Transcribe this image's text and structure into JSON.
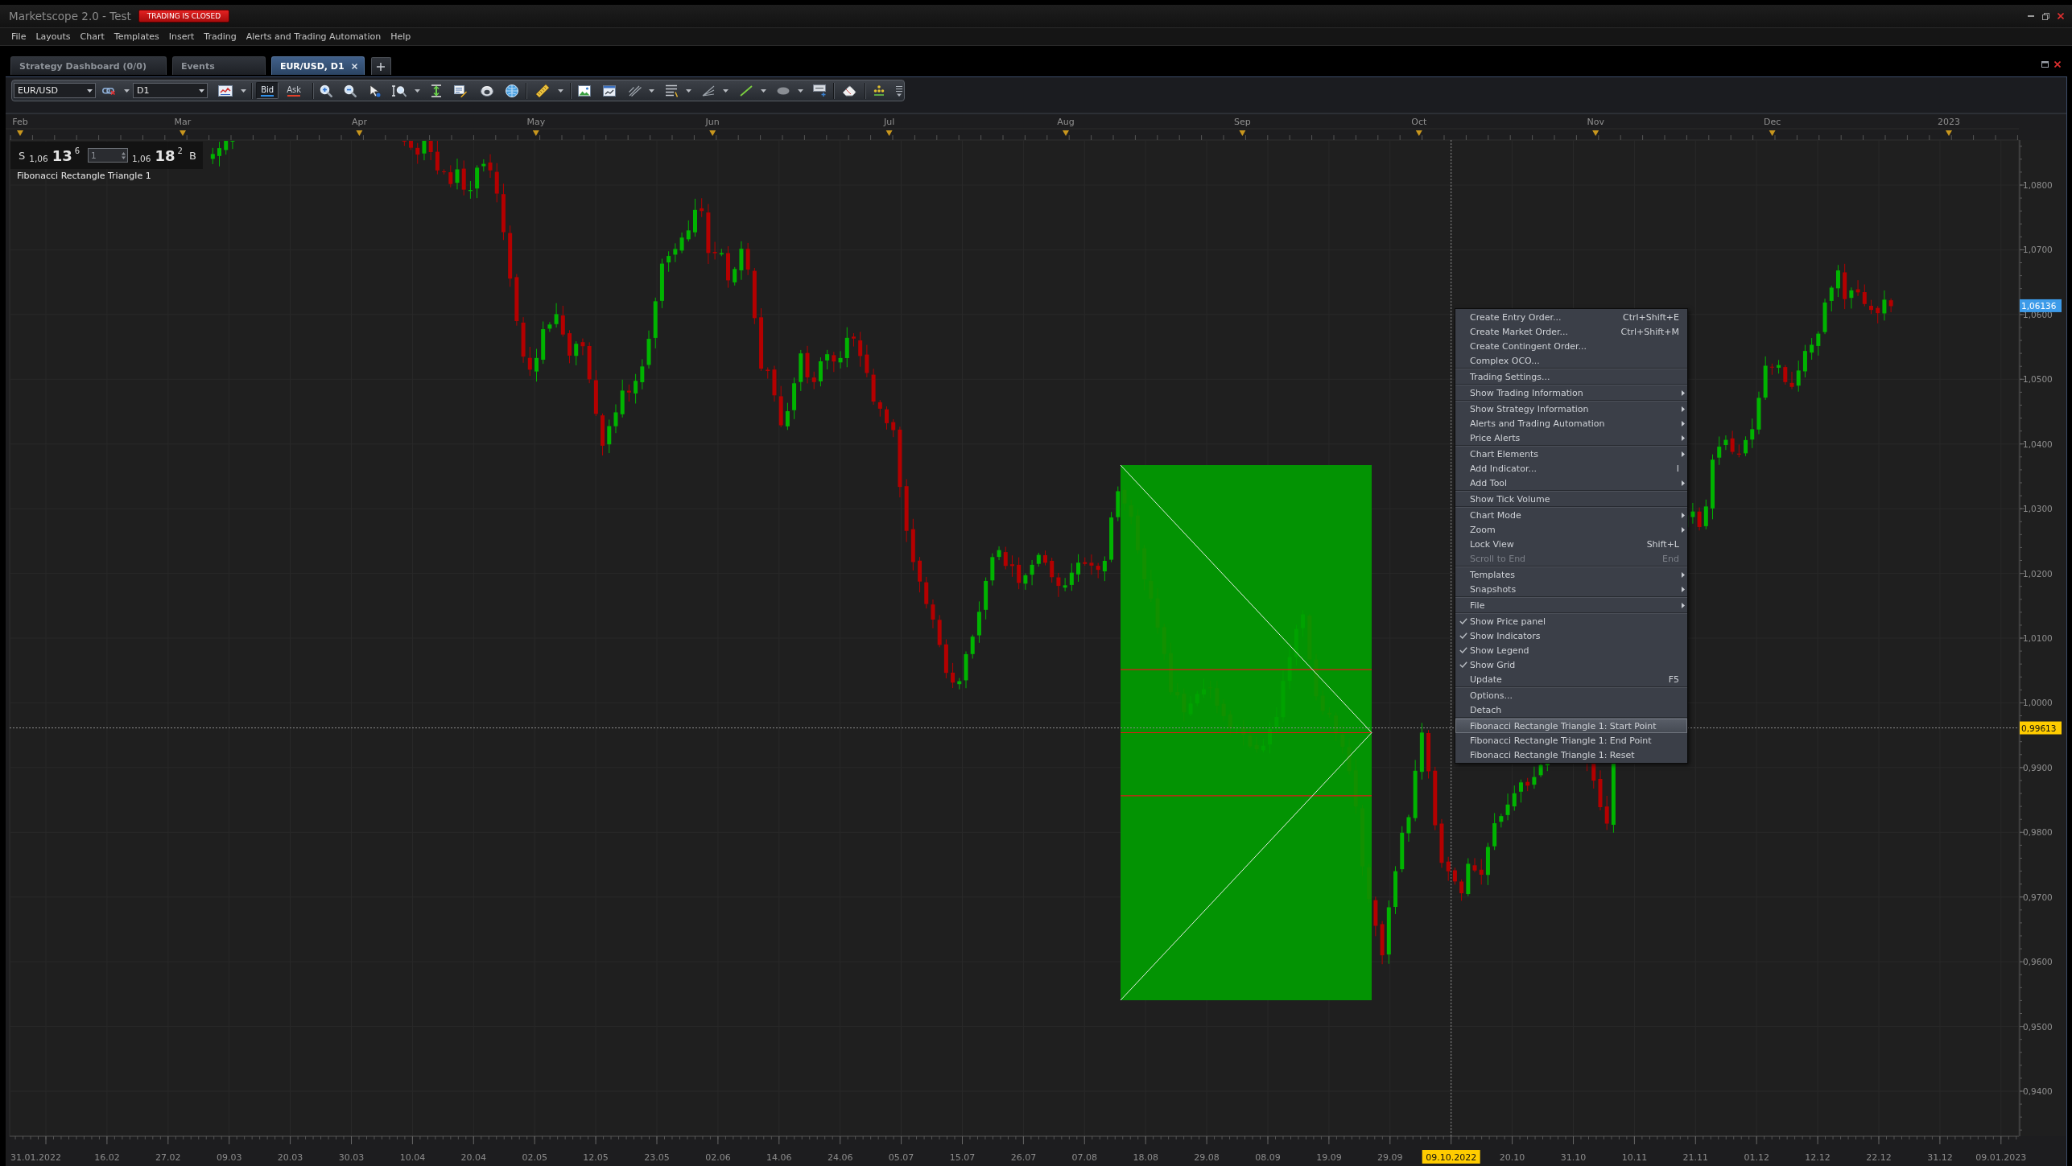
{
  "window": {
    "title": "Marketscope 2.0 - Test",
    "status_badge": "TRADING IS CLOSED"
  },
  "menu_bar": [
    "File",
    "Layouts",
    "Chart",
    "Templates",
    "Insert",
    "Trading",
    "Alerts and Trading Automation",
    "Help"
  ],
  "tabs": [
    {
      "label": "Strategy Dashboard (0/0)",
      "selected": false
    },
    {
      "label": "Events",
      "selected": false
    },
    {
      "label": "EUR/USD, D1",
      "selected": true
    }
  ],
  "toolbar": {
    "symbol": "EUR/USD",
    "timeframe": "D1",
    "quote_sides": [
      {
        "label": "Bid",
        "selected": true,
        "color": "#2f8fe8"
      },
      {
        "label": "Ask",
        "selected": false,
        "color": "#e0402a"
      }
    ]
  },
  "chart": {
    "price_panel": {
      "sell_label": "S",
      "sell_big_figure": "1,06",
      "sell_pips": "13",
      "sell_fraction": "6",
      "amount": "1",
      "buy_big_figure": "1,06",
      "buy_pips": "18",
      "buy_fraction": "2",
      "buy_label": "B"
    },
    "drawings": [
      {
        "kind": "fibonacci_rectangle_triangle",
        "legend": "Fibonacci Rectangle Triangle 1"
      }
    ],
    "month_axis": [
      "Feb",
      "Mar",
      "Apr",
      "May",
      "Jun",
      "Jul",
      "Aug",
      "Sep",
      "Oct",
      "Nov",
      "Dec",
      "2023"
    ],
    "price_axis": {
      "labels": [
        "1,0800",
        "1,0700",
        "1,0600",
        "1,0500",
        "1,0400",
        "1,0300",
        "1,0200",
        "1,0100",
        "1,0000",
        "0,9900",
        "0,9800",
        "0,9700",
        "0,9600",
        "0,9500",
        "0,9400"
      ],
      "markers": [
        {
          "value": "1,06136",
          "kind": "current"
        },
        {
          "value": "0,99613",
          "kind": "crosshair"
        }
      ]
    },
    "date_axis": [
      {
        "label": "31.01.2022",
        "highlighted": false
      },
      {
        "label": "16.02",
        "highlighted": false
      },
      {
        "label": "27.02",
        "highlighted": false
      },
      {
        "label": "09.03",
        "highlighted": false
      },
      {
        "label": "20.03",
        "highlighted": false
      },
      {
        "label": "30.03",
        "highlighted": false
      },
      {
        "label": "10.04",
        "highlighted": false
      },
      {
        "label": "20.04",
        "highlighted": false
      },
      {
        "label": "02.05",
        "highlighted": false
      },
      {
        "label": "12.05",
        "highlighted": false
      },
      {
        "label": "23.05",
        "highlighted": false
      },
      {
        "label": "02.06",
        "highlighted": false
      },
      {
        "label": "14.06",
        "highlighted": false
      },
      {
        "label": "24.06",
        "highlighted": false
      },
      {
        "label": "05.07",
        "highlighted": false
      },
      {
        "label": "15.07",
        "highlighted": false
      },
      {
        "label": "26.07",
        "highlighted": false
      },
      {
        "label": "07.08",
        "highlighted": false
      },
      {
        "label": "18.08",
        "highlighted": false
      },
      {
        "label": "29.08",
        "highlighted": false
      },
      {
        "label": "08.09",
        "highlighted": false
      },
      {
        "label": "19.09",
        "highlighted": false
      },
      {
        "label": "29.09",
        "highlighted": false
      },
      {
        "label": "09.10.2022",
        "highlighted": true
      },
      {
        "label": "20.10",
        "highlighted": false
      },
      {
        "label": "31.10",
        "highlighted": false
      },
      {
        "label": "10.11",
        "highlighted": false
      },
      {
        "label": "21.11",
        "highlighted": false
      },
      {
        "label": "01.12",
        "highlighted": false
      },
      {
        "label": "12.12",
        "highlighted": false
      },
      {
        "label": "22.12",
        "highlighted": false
      },
      {
        "label": "31.12",
        "highlighted": false
      },
      {
        "label": "09.01.2023",
        "highlighted": false
      }
    ],
    "context_menu": {
      "groups": [
        [
          {
            "label": "Create Entry Order...",
            "shortcut": "Ctrl+Shift+E",
            "submenu": false,
            "checked": false,
            "disabled": false,
            "selected": false
          },
          {
            "label": "Create Market Order...",
            "shortcut": "Ctrl+Shift+M",
            "submenu": false,
            "checked": false,
            "disabled": false,
            "selected": false
          },
          {
            "label": "Create Contingent Order...",
            "submenu": false,
            "checked": false,
            "disabled": false,
            "selected": false
          },
          {
            "label": "Complex OCO...",
            "submenu": false,
            "checked": false,
            "disabled": false,
            "selected": false
          }
        ],
        [
          {
            "label": "Trading Settings...",
            "submenu": false,
            "checked": false,
            "disabled": false,
            "selected": false
          }
        ],
        [
          {
            "label": "Show Trading Information",
            "submenu": true,
            "checked": false,
            "disabled": false,
            "selected": false
          }
        ],
        [
          {
            "label": "Show Strategy Information",
            "submenu": true,
            "checked": false,
            "disabled": false,
            "selected": false
          },
          {
            "label": "Alerts and Trading Automation",
            "submenu": true,
            "checked": false,
            "disabled": false,
            "selected": false
          },
          {
            "label": "Price Alerts",
            "submenu": true,
            "checked": false,
            "disabled": false,
            "selected": false
          }
        ],
        [
          {
            "label": "Chart Elements",
            "submenu": true,
            "checked": false,
            "disabled": false,
            "selected": false
          },
          {
            "label": "Add Indicator...",
            "shortcut": "I",
            "submenu": false,
            "checked": false,
            "disabled": false,
            "selected": false
          },
          {
            "label": "Add Tool",
            "submenu": true,
            "checked": false,
            "disabled": false,
            "selected": false
          }
        ],
        [
          {
            "label": "Show Tick Volume",
            "submenu": false,
            "checked": false,
            "disabled": false,
            "selected": false
          }
        ],
        [
          {
            "label": "Chart Mode",
            "submenu": true,
            "checked": false,
            "disabled": false,
            "selected": false
          },
          {
            "label": "Zoom",
            "submenu": true,
            "checked": false,
            "disabled": false,
            "selected": false
          },
          {
            "label": "Lock View",
            "shortcut": "Shift+L",
            "submenu": false,
            "checked": false,
            "disabled": false,
            "selected": false
          },
          {
            "label": "Scroll to End",
            "shortcut": "End",
            "submenu": false,
            "checked": false,
            "disabled": true,
            "selected": false
          }
        ],
        [
          {
            "label": "Templates",
            "submenu": true,
            "checked": false,
            "disabled": false,
            "selected": false
          },
          {
            "label": "Snapshots",
            "submenu": true,
            "checked": false,
            "disabled": false,
            "selected": false
          }
        ],
        [
          {
            "label": "File",
            "submenu": true,
            "checked": false,
            "disabled": false,
            "selected": false
          }
        ],
        [
          {
            "label": "Show Price panel",
            "submenu": false,
            "checked": true,
            "disabled": false,
            "selected": false
          },
          {
            "label": "Show Indicators",
            "submenu": false,
            "checked": true,
            "disabled": false,
            "selected": false
          },
          {
            "label": "Show Legend",
            "submenu": false,
            "checked": true,
            "disabled": false,
            "selected": false
          },
          {
            "label": "Show Grid",
            "submenu": false,
            "checked": true,
            "disabled": false,
            "selected": false
          },
          {
            "label": "Update",
            "shortcut": "F5",
            "submenu": false,
            "checked": false,
            "disabled": false,
            "selected": false
          }
        ],
        [
          {
            "label": "Options...",
            "submenu": false,
            "checked": false,
            "disabled": false,
            "selected": false
          },
          {
            "label": "Detach",
            "submenu": false,
            "checked": false,
            "disabled": false,
            "selected": false
          }
        ],
        [
          {
            "label": "Fibonacci Rectangle Triangle 1: Start Point",
            "submenu": false,
            "checked": false,
            "disabled": false,
            "selected": true
          },
          {
            "label": "Fibonacci Rectangle Triangle 1: End Point",
            "submenu": false,
            "checked": false,
            "disabled": false,
            "selected": false
          },
          {
            "label": "Fibonacci Rectangle Triangle 1: Reset",
            "submenu": false,
            "checked": false,
            "disabled": false,
            "selected": false
          }
        ]
      ]
    }
  }
}
